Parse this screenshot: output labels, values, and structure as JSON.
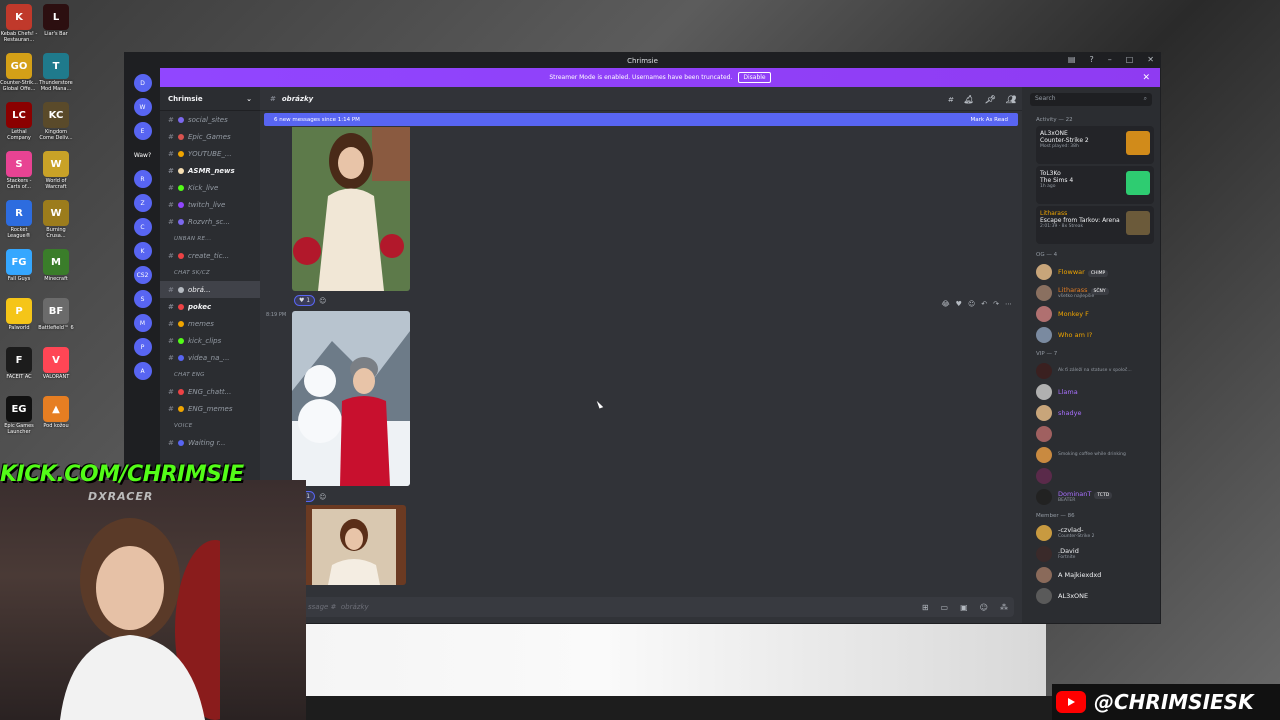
{
  "desktop_icons": [
    {
      "label": "Kebab Chefs! - Restauran...",
      "color": "#c0392b",
      "glyph": "K"
    },
    {
      "label": "Liar's Bar",
      "color": "#2c0f10",
      "glyph": "L"
    },
    {
      "label": "Counter-Strik... Global Offe...",
      "color": "#d4a017",
      "glyph": "GO"
    },
    {
      "label": "Thunderstore Mod Mana...",
      "color": "#1f7a8c",
      "glyph": "T"
    },
    {
      "label": "Lethal Company",
      "color": "#8b0000",
      "glyph": "LC"
    },
    {
      "label": "Kingdom Come Deliv...",
      "color": "#5a4a2a",
      "glyph": "KC"
    },
    {
      "label": "Stackers - Carts of...",
      "color": "#e84393",
      "glyph": "S"
    },
    {
      "label": "World of Warcraft",
      "color": "#c9a227",
      "glyph": "W"
    },
    {
      "label": "Rocket League®",
      "color": "#2d6cdf",
      "glyph": "R"
    },
    {
      "label": "Burning Crusa...",
      "color": "#9c7c1c",
      "glyph": "W"
    },
    {
      "label": "Fall Guys",
      "color": "#35a7ff",
      "glyph": "FG"
    },
    {
      "label": "Minecraft",
      "color": "#3a7d2a",
      "glyph": "M"
    },
    {
      "label": "Palworld",
      "color": "#f5c518",
      "glyph": "P"
    },
    {
      "label": "Battlefield™ 6",
      "color": "#6b6b6b",
      "glyph": "BF"
    },
    {
      "label": "FACEIT AC",
      "color": "#1c1c1c",
      "glyph": "F"
    },
    {
      "label": "VALORANT",
      "color": "#ff4655",
      "glyph": "V"
    },
    {
      "label": "Epic Games Launcher",
      "color": "#111111",
      "glyph": "EG"
    },
    {
      "label": "Pod kožou",
      "color": "#e67e22",
      "glyph": "▲"
    }
  ],
  "window": {
    "title": "Chrimsie",
    "banner_text": "Streamer Mode is enabled. Usernames have been truncated.",
    "banner_button": "Disable",
    "close_glyph": "✕"
  },
  "servers": [
    "D",
    "W",
    "E",
    "Waw?",
    "R",
    "Z",
    "C",
    "K",
    "CS2",
    "S",
    "M",
    "P",
    "A"
  ],
  "guild": {
    "name": "Chrimsie",
    "channels": [
      {
        "type": "channel",
        "name": "social_sites",
        "emoji": "#7b68ee"
      },
      {
        "type": "channel",
        "name": "Epic_Games",
        "emoji": "#d9534f"
      },
      {
        "type": "channel",
        "name": "YOUTUBE_...",
        "emoji": "#f0a500"
      },
      {
        "type": "channel",
        "name": "ASMR_news",
        "emoji": "#f5deb3",
        "bold": true
      },
      {
        "type": "channel",
        "name": "Kick_live",
        "emoji": "#53fc18"
      },
      {
        "type": "channel",
        "name": "twitch_live",
        "emoji": "#9146ff"
      },
      {
        "type": "channel",
        "name": "Rozvrh_sc...",
        "emoji": "#7b68ee"
      },
      {
        "type": "category",
        "name": "UNBAN RE..."
      },
      {
        "type": "channel",
        "name": "create_tic...",
        "emoji": "#ed4245"
      },
      {
        "type": "category",
        "name": "CHAT SK/CZ"
      },
      {
        "type": "channel",
        "name": "obrá...",
        "emoji": "#b5bac1",
        "selected": true
      },
      {
        "type": "channel",
        "name": "pokec",
        "emoji": "#ed4245",
        "bold": true
      },
      {
        "type": "channel",
        "name": "memes",
        "emoji": "#f0a500"
      },
      {
        "type": "channel",
        "name": "kick_clips",
        "emoji": "#53fc18"
      },
      {
        "type": "channel",
        "name": "videa_na_...",
        "emoji": "#5865f2"
      },
      {
        "type": "category",
        "name": "CHAT ENG"
      },
      {
        "type": "channel",
        "name": "ENG_chatt...",
        "emoji": "#ed4245"
      },
      {
        "type": "channel",
        "name": "ENG_memes",
        "emoji": "#f0a500"
      },
      {
        "type": "category",
        "name": "VOICE"
      },
      {
        "type": "channel",
        "name": "Waiting r...",
        "emoji": "#5865f2"
      }
    ]
  },
  "main": {
    "channel_title": "obrázky",
    "new_messages": "6 new messages since 1:14 PM",
    "mark_as_read": "Mark As Read",
    "timestamp": "8:19 PM",
    "reaction_count_1": "1",
    "reaction_count_2": "1",
    "input_placeholder": "ssage #",
    "input_channel": "obrázky"
  },
  "members": {
    "search_placeholder": "Search",
    "activity_header": "Activity — 22",
    "activities": [
      {
        "name": "AL3xONE",
        "game": "Counter-Strike 2",
        "sub": "Most played: 38h",
        "color": "#f2f3f5",
        "art": "#d18b1a"
      },
      {
        "name": "ToL3Ko",
        "game": "The Sims 4",
        "sub": "1h ago",
        "color": "#f2f3f5",
        "art": "#2ecc71"
      },
      {
        "name": "Litharass",
        "game": "Escape from Tarkov: Arena",
        "sub": "2:01:39 · 8x Streak",
        "color": "#f0a500",
        "art": "#6b5a3a"
      }
    ],
    "og_header": "OG — 4",
    "og": [
      {
        "name": "Flowwar",
        "color": "#f0a500",
        "tag": "CHIMP",
        "av": "#c8a57a"
      },
      {
        "name": "Litharass",
        "color": "#e67e22",
        "tag": "SČNY",
        "sub": "všetko najlepšie",
        "av": "#8a7060"
      },
      {
        "name": "Monkey F",
        "color": "#f0a500",
        "av": "#b07070"
      },
      {
        "name": "Who am I?",
        "color": "#f0a500",
        "av": "#7a8aa0"
      }
    ],
    "vip_header": "VIP — 7",
    "vip": [
      {
        "name": "",
        "color": "#c678dd",
        "sub": "Ak ťi záleží na statuse v spoloč...",
        "av": "#3a2020"
      },
      {
        "name": "Llama",
        "color": "#a970ff",
        "av": "#b0b0b0"
      },
      {
        "name": "shadye",
        "color": "#a970ff",
        "av": "#c8a57a"
      },
      {
        "name": "",
        "color": "#a970ff",
        "av": "#a06060"
      },
      {
        "name": "",
        "color": "#a970ff",
        "sub": "Smoking coffee while drinking",
        "av": "#c98a40"
      },
      {
        "name": "",
        "color": "#a970ff",
        "av": "#5a2a4a"
      },
      {
        "name": "DominanT",
        "color": "#a970ff",
        "tag": "TCTD",
        "sub": "BEATER",
        "av": "#222222"
      }
    ],
    "member_header": "Member — 86",
    "members_list": [
      {
        "name": "-czvlad-",
        "color": "#f2f3f5",
        "sub": "Counter-Strike 2",
        "av": "#c89a40"
      },
      {
        "name": ".David",
        "color": "#f2f3f5",
        "sub": "Fortnite",
        "av": "#3a2a2a"
      },
      {
        "name": "A Majkiexdxd",
        "color": "#f2f3f5",
        "av": "#8a6a5a"
      },
      {
        "name": "AL3xONE",
        "color": "#f2f3f5",
        "av": "#5a5a5a"
      }
    ]
  },
  "overlay": {
    "kick_text": "KICK.COM/CHRIMSIE",
    "chair_brand": "DXRACER",
    "youtube_handle": "@CHRIMSIESK"
  }
}
